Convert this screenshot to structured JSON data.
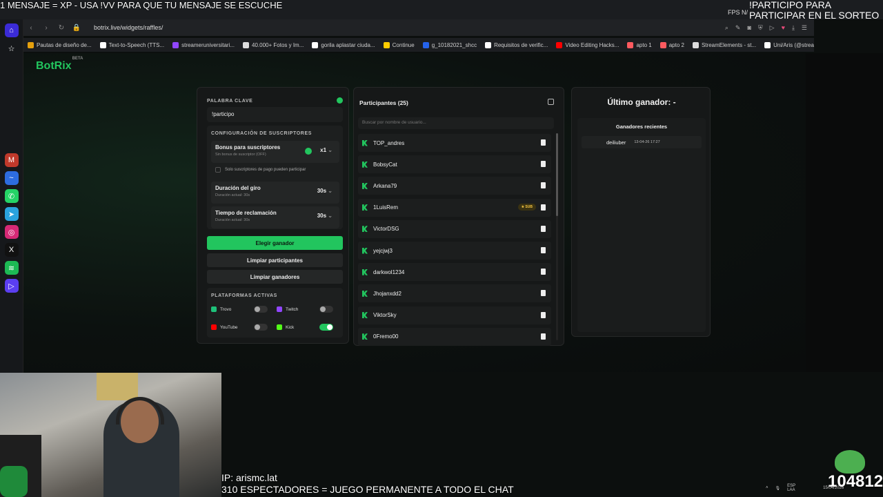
{
  "overlay": {
    "top_left": "1 MENSAJE = XP - USA !VV PARA QUE TU MENSAJE SE ESCUCHE",
    "top_right_1": "!PARTICIPO PARA",
    "top_right_2": "PARTICIPAR EN EL SORTEO",
    "fps": "FPS  N/",
    "ip": "IP: arismc.lat",
    "viewers": "310 ESPECTADORES = JUEGO PERMANENTE A TODO EL CHAT",
    "counter": "104812"
  },
  "browser": {
    "url": "botrix.live/widgets/raffles/",
    "bookmarks": [
      {
        "label": "Pautas de diseño de...",
        "color": "#e5a00d"
      },
      {
        "label": "Text-to-Speech (TTS...",
        "color": "#ffffff"
      },
      {
        "label": "streameruniversitari...",
        "color": "#9146ff"
      },
      {
        "label": "40.000+ Fotos y Im...",
        "color": "#dddddd"
      },
      {
        "label": "gorila aplastar ciuda...",
        "color": "#ffffff"
      },
      {
        "label": "Continue",
        "color": "#ffcc00"
      },
      {
        "label": "g_10182021_shcc",
        "color": "#2563eb"
      },
      {
        "label": "Requisitos de verific...",
        "color": "#ffffff"
      },
      {
        "label": "Video Editing Hacks...",
        "color": "#ff0000"
      },
      {
        "label": "apto 1",
        "color": "#ff5a5f"
      },
      {
        "label": "apto 2",
        "color": "#ff5a5f"
      },
      {
        "label": "StreamElements - st...",
        "color": "#dddddd"
      },
      {
        "label": "Uni/Aris (@streame...",
        "color": "#ffffff"
      }
    ]
  },
  "app": {
    "logo": "BotRix",
    "logo_badge": "BETA"
  },
  "config": {
    "keyword_label": "PALABRA CLAVE",
    "keyword_value": "!participo",
    "subs_section": "CONFIGURACIÓN DE SUSCRIPTORES",
    "bonus_title": "Bonus para suscriptores",
    "bonus_sub": "Sin bonus de suscriptor (OFF)",
    "bonus_value": "x1",
    "only_subs": "Solo suscriptores de pago pueden participar",
    "spin_title": "Duración del giro",
    "spin_sub": "Duración actual: 30s",
    "spin_value": "30s",
    "claim_title": "Tiempo de reclamación",
    "claim_sub": "Duración actual: 30s",
    "claim_value": "30s",
    "btn_pick": "Elegir ganador",
    "btn_clear_participants": "Limpiar participantes",
    "btn_clear_winners": "Limpiar ganadores",
    "platforms_label": "PLATAFORMAS ACTIVAS",
    "platforms": [
      {
        "name": "Trovo",
        "on": false,
        "color": "#1ec17a"
      },
      {
        "name": "Twitch",
        "on": false,
        "color": "#9146ff"
      },
      {
        "name": "YouTube",
        "on": false,
        "color": "#ff0000"
      },
      {
        "name": "Kick",
        "on": true,
        "color": "#53fc18"
      }
    ]
  },
  "participants": {
    "title": "Participantes (25)",
    "search_placeholder": "Buscar por nombre de usuario...",
    "list": [
      {
        "name": "TOP_andres",
        "sub": ""
      },
      {
        "name": "BobsyCat",
        "sub": ""
      },
      {
        "name": "Arkana79",
        "sub": ""
      },
      {
        "name": "1LuisRem",
        "sub": "★ SUB"
      },
      {
        "name": "VictorDSG",
        "sub": ""
      },
      {
        "name": "yejcjwj3",
        "sub": ""
      },
      {
        "name": "darkwol1234",
        "sub": ""
      },
      {
        "name": "Jhojanxdd2",
        "sub": ""
      },
      {
        "name": "ViktorSky",
        "sub": ""
      },
      {
        "name": "0Fremo00",
        "sub": ""
      }
    ]
  },
  "winner": {
    "title": "Último ganador: -",
    "recent_label": "Ganadores recientes",
    "recent": [
      {
        "name": "deiliuber",
        "time": "13-04-26 17:27"
      }
    ]
  },
  "taskbar": {
    "lang": "ESP",
    "layout": "LAA",
    "date": "15/04/2026"
  }
}
